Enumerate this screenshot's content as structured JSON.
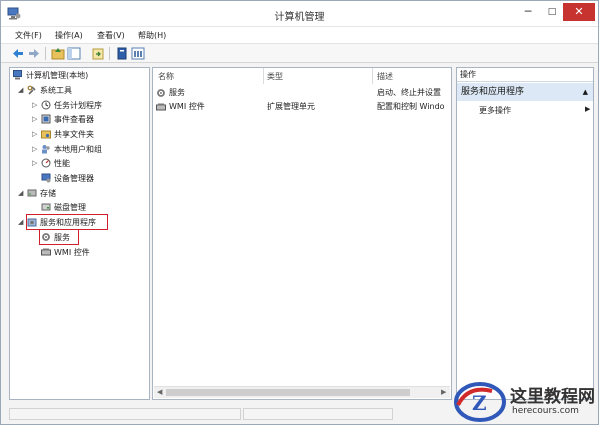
{
  "window": {
    "title": "计算机管理"
  },
  "controls": {
    "minimize": "─",
    "maximize": "□",
    "close": "✕"
  },
  "menu": [
    "文件(F)",
    "操作(A)",
    "查看(V)",
    "帮助(H)"
  ],
  "tree": {
    "root": "计算机管理(本地)",
    "system_tools": "系统工具",
    "task_scheduler": "任务计划程序",
    "event_viewer": "事件查看器",
    "shared_folders": "共享文件夹",
    "local_users": "本地用户和组",
    "performance": "性能",
    "device_manager": "设备管理器",
    "storage": "存储",
    "disk_management": "磁盘管理",
    "services_apps": "服务和应用程序",
    "services": "服务",
    "wmi": "WMI 控件"
  },
  "list": {
    "columns": {
      "name": "名称",
      "type": "类型",
      "desc": "描述"
    },
    "rows": [
      {
        "name": "服务",
        "type": "",
        "desc": "启动、终止并设置"
      },
      {
        "name": "WMI 控件",
        "type": "扩展管理单元",
        "desc": "配置和控制 Windo"
      }
    ]
  },
  "actions": {
    "header": "操作",
    "section": "服务和应用程序",
    "item": "更多操作"
  },
  "watermark": {
    "brand": "这里教程网",
    "url": "herecours.com",
    "logo_letter": "Z"
  },
  "colors": {
    "highlight_box": "#d0202c",
    "section_bg": "#dce8f5",
    "close_btn": "#c7332e"
  },
  "icons": [
    "back-icon",
    "forward-icon",
    "up-icon",
    "show-tree-icon",
    "export-icon",
    "help-icon",
    "properties-icon"
  ]
}
